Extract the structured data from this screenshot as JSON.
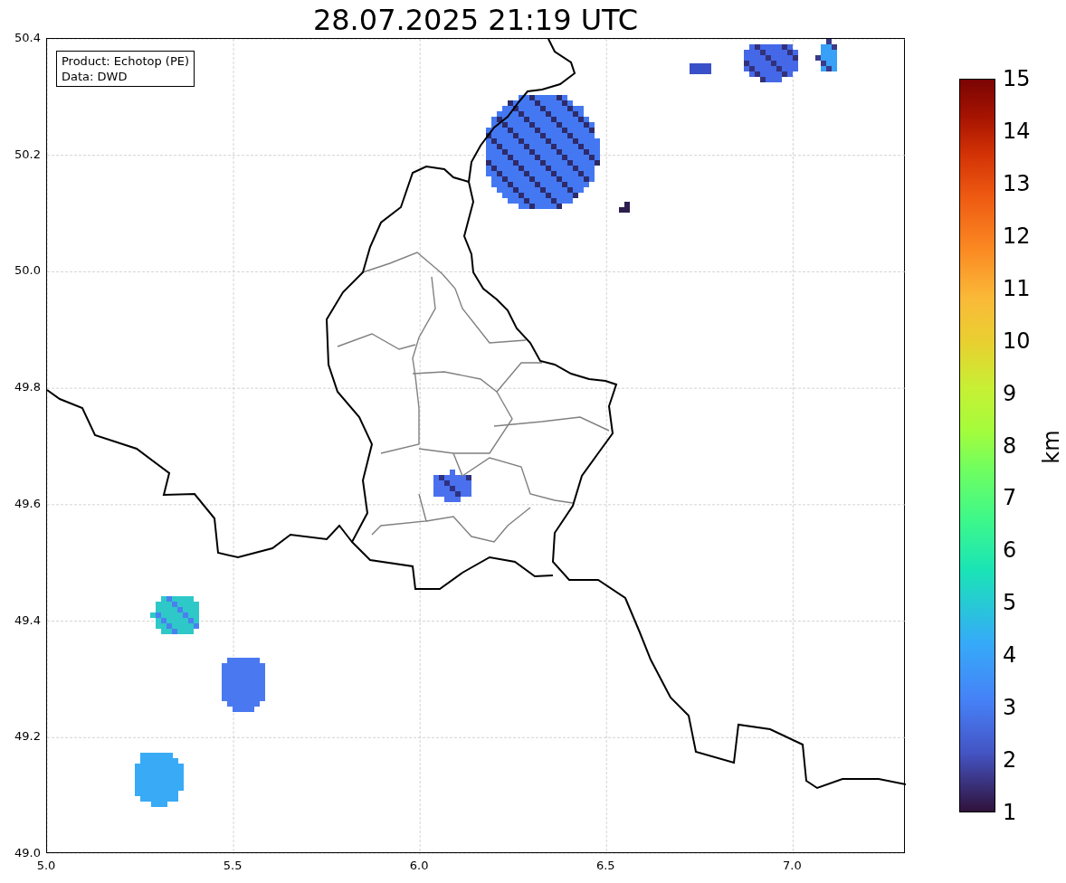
{
  "title": "28.07.2025 21:19 UTC",
  "legend": {
    "lines": [
      "Product: Echotop (PE)",
      "Data: DWD"
    ]
  },
  "x_ticks": [
    "5.0",
    "5.5",
    "6.0",
    "6.5",
    "7.0"
  ],
  "y_ticks": [
    "50.4",
    "50.2",
    "50.0",
    "49.8",
    "49.6",
    "49.4",
    "49.2",
    "49.0"
  ],
  "colorbar": {
    "label": "km",
    "ticks": [
      "15",
      "14",
      "13",
      "12",
      "11",
      "10",
      "9",
      "8",
      "7",
      "6",
      "5",
      "4",
      "3",
      "2",
      "1"
    ]
  }
}
